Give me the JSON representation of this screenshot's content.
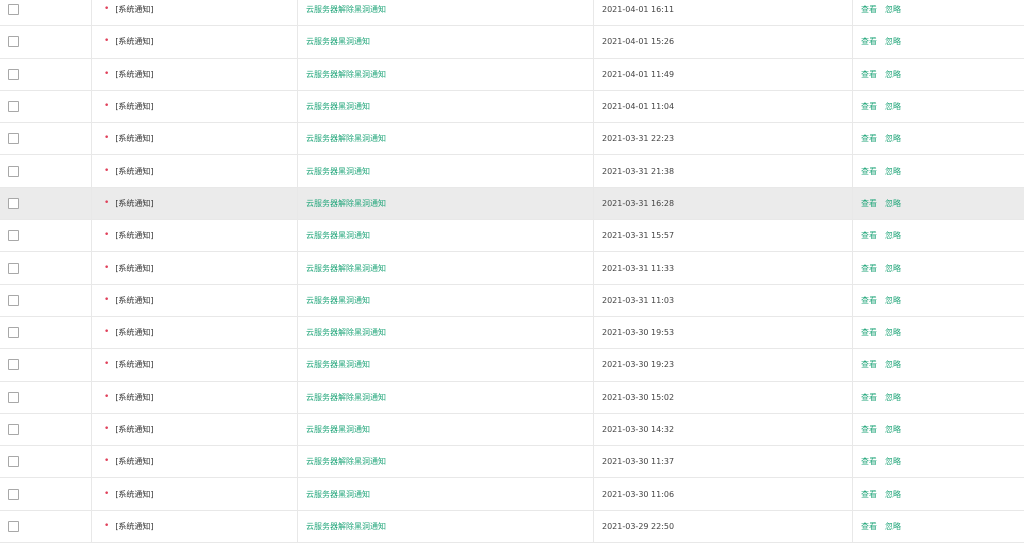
{
  "colors": {
    "link": "#21a67a",
    "dot": "#e0405a",
    "highlight_row": "#ebebeb"
  },
  "rows": [
    {
      "type": "[系统通知]",
      "title": "云服务器解除黑洞通知",
      "time": "2021-04-01 16:11",
      "view": "查看",
      "ignore": "忽略"
    },
    {
      "type": "[系统通知]",
      "title": "云服务器黑洞通知",
      "time": "2021-04-01 15:26",
      "view": "查看",
      "ignore": "忽略"
    },
    {
      "type": "[系统通知]",
      "title": "云服务器解除黑洞通知",
      "time": "2021-04-01 11:49",
      "view": "查看",
      "ignore": "忽略"
    },
    {
      "type": "[系统通知]",
      "title": "云服务器黑洞通知",
      "time": "2021-04-01 11:04",
      "view": "查看",
      "ignore": "忽略"
    },
    {
      "type": "[系统通知]",
      "title": "云服务器解除黑洞通知",
      "time": "2021-03-31 22:23",
      "view": "查看",
      "ignore": "忽略"
    },
    {
      "type": "[系统通知]",
      "title": "云服务器黑洞通知",
      "time": "2021-03-31 21:38",
      "view": "查看",
      "ignore": "忽略"
    },
    {
      "type": "[系统通知]",
      "title": "云服务器解除黑洞通知",
      "time": "2021-03-31 16:28",
      "view": "查看",
      "ignore": "忽略"
    },
    {
      "type": "[系统通知]",
      "title": "云服务器黑洞通知",
      "time": "2021-03-31 15:57",
      "view": "查看",
      "ignore": "忽略"
    },
    {
      "type": "[系统通知]",
      "title": "云服务器解除黑洞通知",
      "time": "2021-03-31 11:33",
      "view": "查看",
      "ignore": "忽略"
    },
    {
      "type": "[系统通知]",
      "title": "云服务器黑洞通知",
      "time": "2021-03-31 11:03",
      "view": "查看",
      "ignore": "忽略"
    },
    {
      "type": "[系统通知]",
      "title": "云服务器解除黑洞通知",
      "time": "2021-03-30 19:53",
      "view": "查看",
      "ignore": "忽略"
    },
    {
      "type": "[系统通知]",
      "title": "云服务器黑洞通知",
      "time": "2021-03-30 19:23",
      "view": "查看",
      "ignore": "忽略"
    },
    {
      "type": "[系统通知]",
      "title": "云服务器解除黑洞通知",
      "time": "2021-03-30 15:02",
      "view": "查看",
      "ignore": "忽略"
    },
    {
      "type": "[系统通知]",
      "title": "云服务器黑洞通知",
      "time": "2021-03-30 14:32",
      "view": "查看",
      "ignore": "忽略"
    },
    {
      "type": "[系统通知]",
      "title": "云服务器解除黑洞通知",
      "time": "2021-03-30 11:37",
      "view": "查看",
      "ignore": "忽略"
    },
    {
      "type": "[系统通知]",
      "title": "云服务器黑洞通知",
      "time": "2021-03-30 11:06",
      "view": "查看",
      "ignore": "忽略"
    },
    {
      "type": "[系统通知]",
      "title": "云服务器解除黑洞通知",
      "time": "2021-03-29 22:50",
      "view": "查看",
      "ignore": "忽略"
    }
  ]
}
